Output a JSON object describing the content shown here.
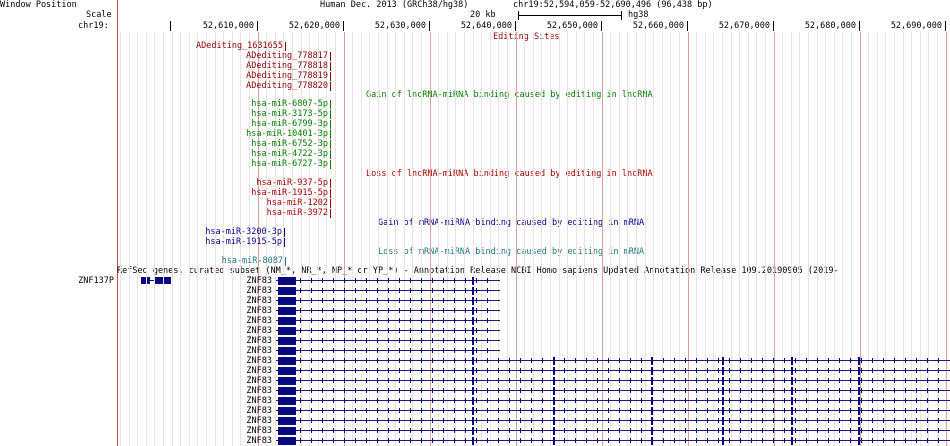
{
  "header": {
    "window_position_label": "Window Position",
    "scale_label": "Scale",
    "chrom_label": "chr19:",
    "assembly": "Human Dec. 2013 (GRCh38/hg38)",
    "position": "chr19:52,594,059-52,690,496 (96,438 bp)",
    "scale_text": "20 kb",
    "scale_assembly": "hg38",
    "ruler_ticks": [
      "52,610,000",
      "52,620,000",
      "52,630,000",
      "52,640,000",
      "52,650,000",
      "52,660,000",
      "52,670,000",
      "52,680,000",
      "52,690,000"
    ]
  },
  "tracks": {
    "editing_sites": {
      "title": "Editing Sites",
      "items": [
        "ADediting_1631655",
        "ADediting_778817",
        "ADediting_778818",
        "ADediting_778819",
        "ADediting_778820"
      ]
    },
    "lnc_gain": {
      "title": "Gain of lncRNA-miRNA binding caused by editing in lncRNA",
      "items": [
        "hsa-miR-6807-5p",
        "hsa-miR-3173-5p",
        "hsa-miR-6799-3p",
        "hsa-miR-10401-3p",
        "hsa-miR-6752-3p",
        "hsa-miR-4722-3p",
        "hsa-miR-6727-3p"
      ]
    },
    "lnc_loss": {
      "title": "Loss of lncRNA-miRNA binding caused by editing in lncRNA",
      "items": [
        "hsa-miR-937-5p",
        "hsa-miR-1915-5p",
        "hsa-miR-1202",
        "hsa-miR-3972"
      ]
    },
    "mrna_gain": {
      "title": "Gain of mRNA-miRNA binding caused by editing in mRNA",
      "items": [
        "hsa-miR-3200-3p",
        "hsa-miR-1915-5p"
      ]
    },
    "mrna_loss": {
      "title": "Loss of mRNA-miRNA binding caused by editing in mRNA",
      "items": [
        "hsa-miR-8087"
      ]
    },
    "refseq": {
      "title": "RefSeq genes, curated subset (NM_*, NR_*, NP_* or YP_*) - Annotation Release NCBI Homo sapiens Updated Annotation Release 109.20190905 (2019-",
      "left_gene": "ZNF137P",
      "transcripts": [
        "ZNF83",
        "ZNF83",
        "ZNF83",
        "ZNF83",
        "ZNF83",
        "ZNF83",
        "ZNF83",
        "ZNF83",
        "ZNF83",
        "ZNF83",
        "ZNF83",
        "ZNF83",
        "ZNF83",
        "ZNF83",
        "ZNF83",
        "ZNF83",
        "ZNF83"
      ]
    }
  },
  "colors": {
    "editing": "#8b0000",
    "gain": "#008000",
    "loss": "#a80000",
    "mrna_gain": "#00008b",
    "mrna_loss": "#1a7a7a",
    "gene": "#0a0a80"
  }
}
